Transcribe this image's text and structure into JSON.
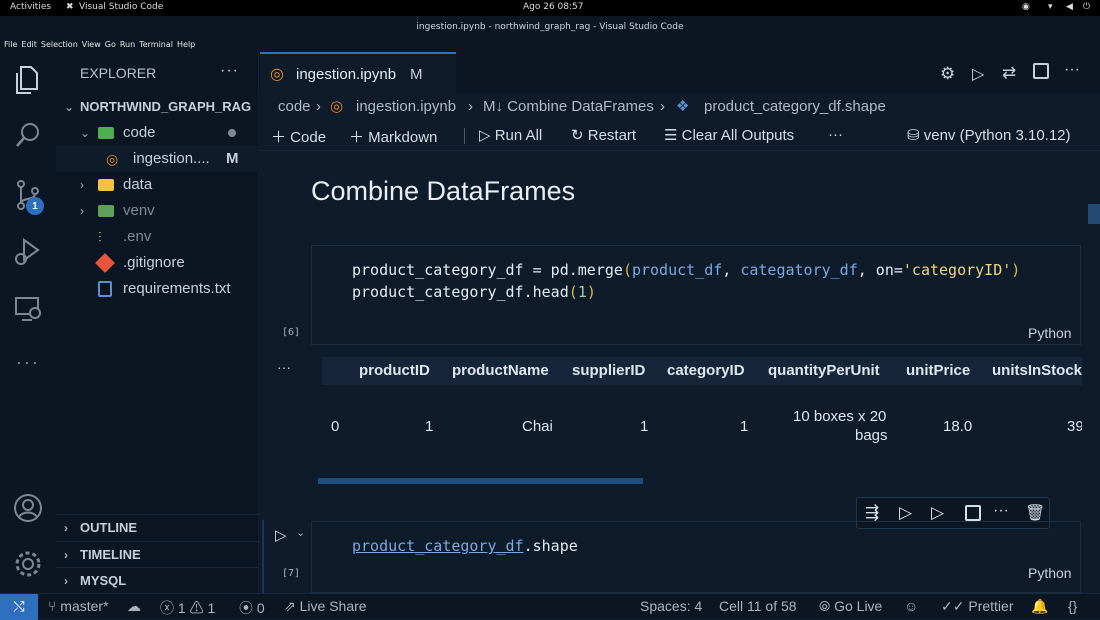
{
  "system_bar": {
    "activities": "Activities",
    "app": "Visual Studio Code",
    "clock": "Ago 26  08:57"
  },
  "window_title": "ingestion.ipynb - northwind_graph_rag - Visual Studio Code",
  "menu": [
    "File",
    "Edit",
    "Selection",
    "View",
    "Go",
    "Run",
    "Terminal",
    "Help"
  ],
  "activity": {
    "scm_badge": "1"
  },
  "explorer": {
    "title": "EXPLORER",
    "more": "···",
    "root": "NORTHWIND_GRAPH_RAG",
    "items": [
      {
        "label": "code"
      },
      {
        "label": "ingestion....",
        "badge": "M"
      },
      {
        "label": "data"
      },
      {
        "label": "venv"
      },
      {
        "label": ".env"
      },
      {
        "label": ".gitignore"
      },
      {
        "label": "requirements.txt"
      }
    ],
    "sections": [
      "OUTLINE",
      "TIMELINE",
      "MYSQL"
    ]
  },
  "tab": {
    "label": "ingestion.ipynb",
    "badge": "M"
  },
  "breadcrumb": {
    "p1": "code",
    "p2": "ingestion.ipynb",
    "p3": "M↓ Combine DataFrames",
    "p4": "product_category_df.shape"
  },
  "toolbar": {
    "code": "Code",
    "markdown": "Markdown",
    "run_all": "Run All",
    "restart": "Restart",
    "clear": "Clear All Outputs",
    "more": "···",
    "kernel": "venv (Python 3.10.12)"
  },
  "notebook": {
    "heading": "Combine DataFrames",
    "cell1": {
      "exec": "[6]",
      "line1_a": "product_category_df = pd.merge",
      "line1_p": "(",
      "line1_b": "product_df",
      "line1_c": ", ",
      "line1_d": "categatory_df",
      "line1_e": ", on=",
      "line1_f": "'categoryID'",
      "line1_g": ")",
      "line2_a": "product_category_df.head",
      "line2_b": "(",
      "line2_c": "1",
      "line2_d": ")",
      "lang": "Python"
    },
    "output_more": "···",
    "table": {
      "columns": [
        "productID",
        "productName",
        "supplierID",
        "categoryID",
        "quantityPerUnit",
        "unitPrice",
        "unitsInStock"
      ],
      "row": {
        "index": "0",
        "productID": "1",
        "productName": "Chai",
        "supplierID": "1",
        "categoryID": "1",
        "qty1": "10 boxes x 20",
        "qty2": "bags",
        "unitPrice": "18.0",
        "unitsInStock": "39"
      }
    },
    "cell2": {
      "exec": "[7]",
      "code_a": "product_category_df",
      "code_b": ".shape",
      "lang": "Python"
    }
  },
  "status": {
    "branch": "master*",
    "errors": "1",
    "warnings": "1",
    "ports": "0",
    "liveshare": "Live Share",
    "spaces": "Spaces: 4",
    "cell": "Cell 11 of 58",
    "golive": "Go Live",
    "prettier": "Prettier"
  },
  "colors": {
    "accent": "#2f6fbf",
    "bg": "#0d1b2a",
    "string": "#f0d77a",
    "paren": "#d9b93e",
    "var": "#7aa8e0"
  }
}
